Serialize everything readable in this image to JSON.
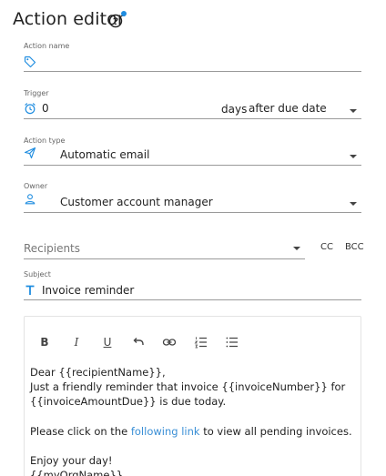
{
  "page": {
    "title": "Action editor"
  },
  "icons": {
    "help": "question-circle-icon",
    "tag": "tag-icon",
    "alarm": "alarm-clock-icon",
    "send": "send-icon",
    "person": "person-icon",
    "text": "text-icon"
  },
  "action_name": {
    "label": "Action name",
    "value": ""
  },
  "trigger": {
    "label": "Trigger",
    "value": "0",
    "unit": "days",
    "condition": "after due date"
  },
  "action_type": {
    "label": "Action type",
    "value": "Automatic email"
  },
  "owner": {
    "label": "Owner",
    "value": "Customer account manager"
  },
  "recipients": {
    "placeholder": "Recipients",
    "cc": "CC",
    "bcc": "BCC"
  },
  "subject": {
    "label": "Subject",
    "value": "Invoice reminder"
  },
  "toolbar": [
    "bold",
    "italic",
    "underline",
    "undo",
    "link",
    "ordered-list",
    "bullet-list"
  ],
  "email_body": {
    "line1": "Dear {{recipientName}},",
    "line2": "Just a friendly reminder that invoice {{invoiceNumber}} for",
    "line3": "{{invoiceAmountDue}} is due today.",
    "line4_before": "Please click on the ",
    "line4_link": "following link",
    "line4_after": " to view all pending invoices.",
    "line5": "Enjoy your day!",
    "line6": "{{myOrgName}}"
  },
  "colors": {
    "accent": "#1f8de0",
    "link": "#3a8fd6"
  }
}
